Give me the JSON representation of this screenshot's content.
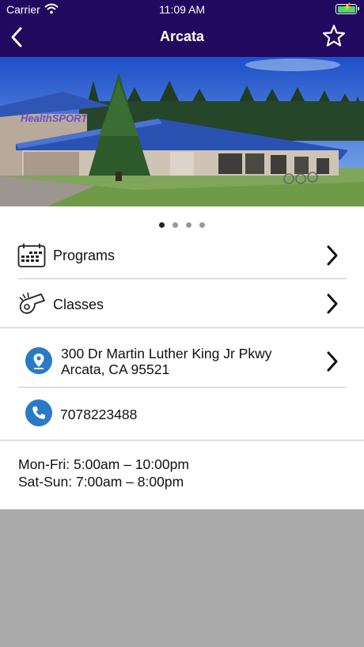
{
  "status_bar": {
    "carrier": "Carrier",
    "time": "11:09 AM"
  },
  "nav": {
    "title": "Arcata"
  },
  "photo": {
    "sign_text": "HealthSPORT"
  },
  "carousel": {
    "page_count": 4,
    "current_page": 1
  },
  "menu": [
    {
      "label": "Programs",
      "icon": "calendar-icon"
    },
    {
      "label": "Classes",
      "icon": "whistle-icon"
    }
  ],
  "contact": {
    "address_line1": "300 Dr Martin Luther King Jr Pkwy",
    "address_line2": "Arcata, CA 95521",
    "phone": "7078223488"
  },
  "hours": {
    "weekday": "Mon-Fri: 5:00am – 10:00pm",
    "weekend": "Sat-Sun: 7:00am – 8:00pm"
  },
  "colors": {
    "header": "#22085e",
    "accent": "#2a7ac4",
    "footer": "#aaaaaa"
  }
}
